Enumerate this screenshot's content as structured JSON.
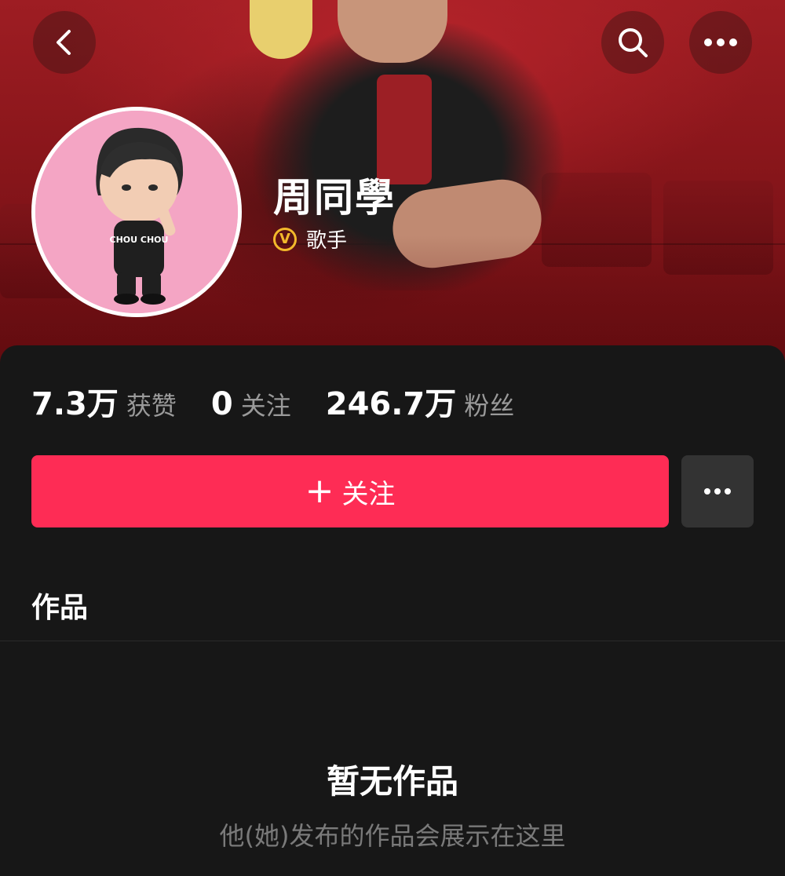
{
  "profile": {
    "name": "周同學",
    "badge_letter": "V",
    "badge_text": "歌手",
    "avatar_shirt_text": "CHOU CHOU"
  },
  "stats": [
    {
      "value": "7.3万",
      "label": "获赞"
    },
    {
      "value": "0",
      "label": "关注"
    },
    {
      "value": "246.7万",
      "label": "粉丝"
    }
  ],
  "actions": {
    "follow_plus": "+",
    "follow_label": "关注"
  },
  "tabs": {
    "works_label": "作品"
  },
  "empty_state": {
    "title": "暂无作品",
    "subtitle": "他(她)发布的作品会展示在这里"
  },
  "icons": {
    "back": "chevron-left-icon",
    "search": "search-icon",
    "more": "more-horizontal-icon"
  },
  "colors": {
    "accent": "#fe2c55",
    "badge": "#f3b92b",
    "background": "#171717"
  }
}
